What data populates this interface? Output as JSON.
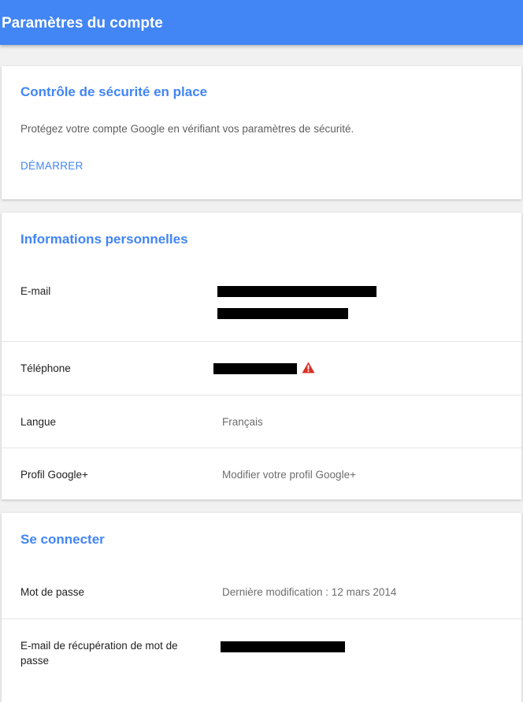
{
  "header": {
    "title": "Paramètres du compte",
    "color": "#4285f4"
  },
  "security_card": {
    "title": "Contrôle de sécurité en place",
    "description": "Protégez votre compte Google en vérifiant vos paramètres de sécurité.",
    "action_label": "DÉMARRER"
  },
  "personal_card": {
    "title": "Informations personnelles",
    "rows": [
      {
        "label": "E-mail",
        "value": ""
      },
      {
        "label": "Téléphone",
        "value": ""
      },
      {
        "label": "Langue",
        "value": "Français"
      },
      {
        "label": "Profil Google+",
        "value": "Modifier votre profil Google+"
      }
    ]
  },
  "signin_card": {
    "title": "Se connecter",
    "rows": [
      {
        "label": "Mot de passe",
        "value": "Dernière modification : 12 mars 2014"
      },
      {
        "label": "E-mail de récupération de mot de passe",
        "value": ""
      }
    ]
  },
  "icons": {
    "phone_warning": "warning-triangle-icon",
    "warning_color": "#d93025"
  }
}
